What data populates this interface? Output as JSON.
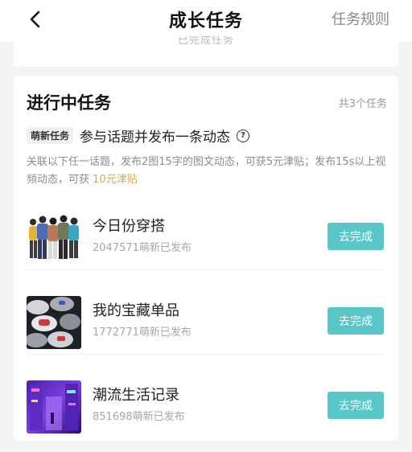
{
  "nav": {
    "title": "成长任务",
    "right_link": "任务规则"
  },
  "previous_card": {
    "faded_text": "已完成任务"
  },
  "in_progress": {
    "title": "进行中任务",
    "count_text": "共3个任务",
    "badge": "萌新任务",
    "task_name": "参与话题并发布一条动态",
    "description": "关联以下任一话题，发布2图15字的图文动态，可获5元津贴；发布15s以上视频动态，可获",
    "description_highlight": "10元津贴"
  },
  "topics": [
    {
      "name": "今日份穿搭",
      "sub": "2047571萌新已发布",
      "button": "去完成",
      "image": "people-group-thumbnail"
    },
    {
      "name": "我的宝藏单品",
      "sub": "1772771萌新已发布",
      "button": "去完成",
      "image": "sneakers-thumbnail"
    },
    {
      "name": "潮流生活记录",
      "sub": "851698萌新已发布",
      "button": "去完成",
      "image": "neon-street-thumbnail"
    }
  ],
  "colors": {
    "accent_button": "#5ac6c7",
    "highlight_text": "#d0aa4c",
    "background": "#f2f3f5"
  }
}
